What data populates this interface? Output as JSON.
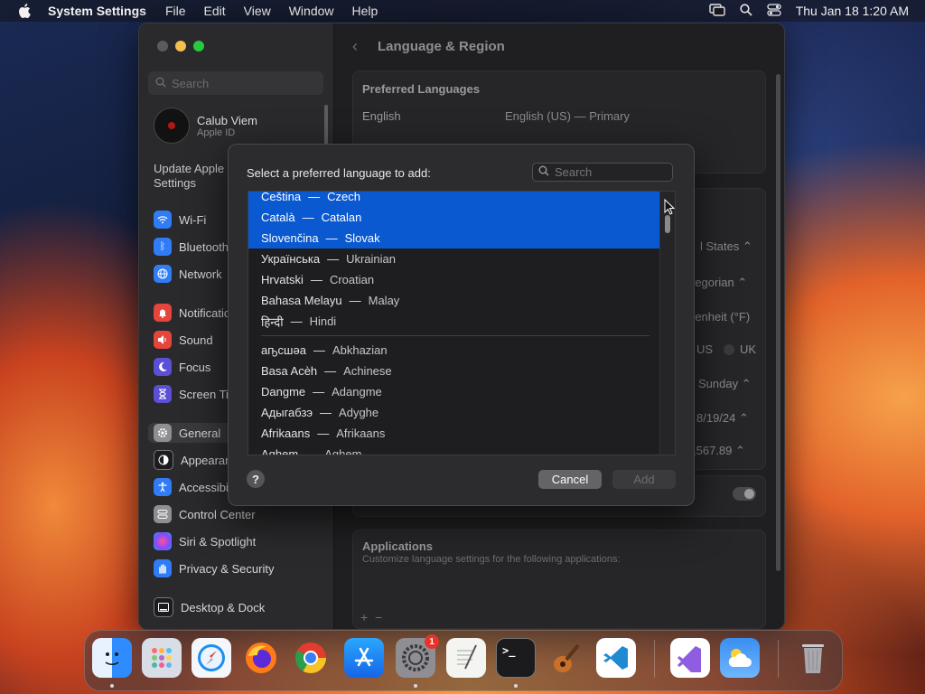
{
  "menubar": {
    "app_name": "System Settings",
    "menus": [
      "File",
      "Edit",
      "View",
      "Window",
      "Help"
    ],
    "clock": "Thu Jan 18  1:20 AM"
  },
  "sidebar": {
    "search_placeholder": "Search",
    "profile_name": "Calub Viem",
    "profile_sub": "Apple ID",
    "update_text": "Update Apple ID Settings",
    "items": [
      {
        "label": "Wi-Fi",
        "color": "#2f7cf6"
      },
      {
        "label": "Bluetooth",
        "color": "#2f7cf6"
      },
      {
        "label": "Network",
        "color": "#2f7cf6"
      },
      {
        "label": "Notifications",
        "color": "#e5453a"
      },
      {
        "label": "Sound",
        "color": "#e5453a"
      },
      {
        "label": "Focus",
        "color": "#5b4fd6"
      },
      {
        "label": "Screen Time",
        "color": "#5b4fd6"
      },
      {
        "label": "General",
        "color": "#8e8e93"
      },
      {
        "label": "Appearance",
        "color": "#1c1c1e"
      },
      {
        "label": "Accessibility",
        "color": "#2f7cf6"
      },
      {
        "label": "Control Center",
        "color": "#8e8e93"
      },
      {
        "label": "Siri & Spotlight",
        "color": "#b14ad8"
      },
      {
        "label": "Privacy & Security",
        "color": "#2f7cf6"
      },
      {
        "label": "Desktop & Dock",
        "color": "#1c1c1e"
      }
    ]
  },
  "content": {
    "title": "Language & Region",
    "preferred_header": "Preferred Languages",
    "pref_lang": "English",
    "pref_lang_detail": "English (US) — Primary",
    "region_value": "l States",
    "calendar_value": "regorian",
    "temperature_value": "renheit (°F)",
    "measure_us": "US",
    "measure_uk": "UK",
    "first_day_value": "Sunday",
    "date_format_value": "8/19/24",
    "number_format_value": ",567.89",
    "applications_header": "Applications",
    "applications_sub": "Customize language settings for the following applications:"
  },
  "dialog": {
    "title": "Select a preferred language to add:",
    "search_placeholder": "Search",
    "languages_top": [
      {
        "native": "Čeština",
        "english": "Czech",
        "selected": true
      },
      {
        "native": "Català",
        "english": "Catalan",
        "selected": true
      },
      {
        "native": "Slovenčina",
        "english": "Slovak",
        "selected": true
      },
      {
        "native": "Українська",
        "english": "Ukrainian",
        "selected": false
      },
      {
        "native": "Hrvatski",
        "english": "Croatian",
        "selected": false
      },
      {
        "native": "Bahasa Melayu",
        "english": "Malay",
        "selected": false
      },
      {
        "native": "हिन्दी",
        "english": "Hindi",
        "selected": false
      }
    ],
    "languages_all": [
      {
        "native": "аҧсшәа",
        "english": "Abkhazian"
      },
      {
        "native": "Basa Acèh",
        "english": "Achinese"
      },
      {
        "native": "Dangme",
        "english": "Adangme"
      },
      {
        "native": "Адыгабзэ",
        "english": "Adyghe"
      },
      {
        "native": "Afrikaans",
        "english": "Afrikaans"
      },
      {
        "native": "Aghem",
        "english": "Aghem"
      }
    ],
    "dash": "—",
    "help_label": "?",
    "cancel_label": "Cancel",
    "add_label": "Add"
  },
  "dock": {
    "badge_count": "1",
    "apps": [
      "finder",
      "launchpad",
      "safari",
      "firefox",
      "chrome",
      "app-store",
      "system-settings",
      "textedit",
      "terminal",
      "garageband",
      "vscode",
      "visual-studio",
      "weather",
      "trash"
    ]
  }
}
